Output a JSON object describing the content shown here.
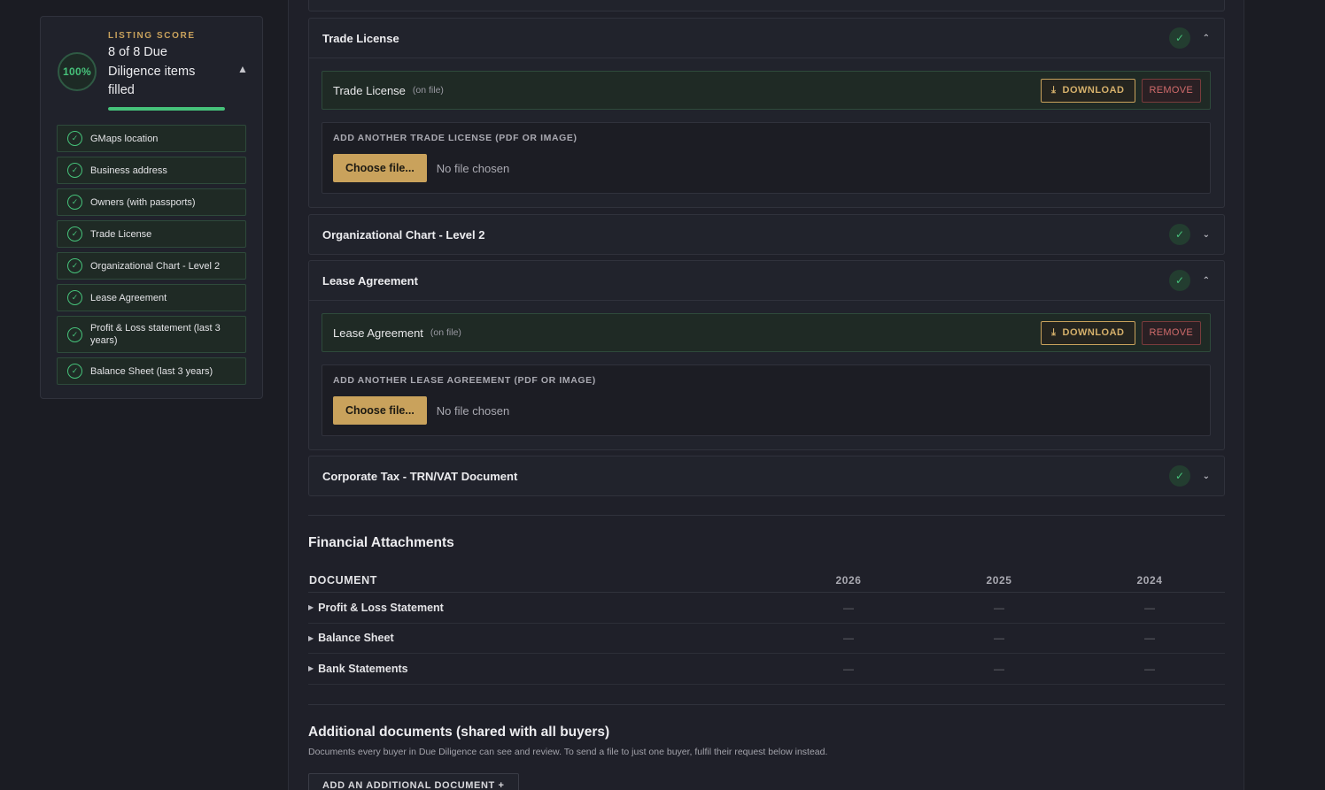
{
  "score": {
    "eyebrow": "LISTING SCORE",
    "percent": "100%",
    "summary": "8 of 8 Due Diligence items filled",
    "progress_fraction": 1.0,
    "collapse_glyph": "▲"
  },
  "checklist": [
    {
      "label": "GMaps location"
    },
    {
      "label": "Business address"
    },
    {
      "label": "Owners (with passports)"
    },
    {
      "label": "Trade License"
    },
    {
      "label": "Organizational Chart - Level 2"
    },
    {
      "label": "Lease Agreement"
    },
    {
      "label": "Profit & Loss statement (last 3 years)"
    },
    {
      "label": "Balance Sheet (last 3 years)"
    }
  ],
  "check_glyph": "✓",
  "documents": {
    "trade_license": {
      "title": "Trade License",
      "file_name": "Trade License",
      "on_file": "(on file)",
      "download": "DOWNLOAD",
      "remove": "REMOVE",
      "upload_label": "ADD ANOTHER TRADE LICENSE (PDF OR IMAGE)",
      "choose": "Choose file...",
      "no_file": "No file chosen"
    },
    "org_chart": {
      "title": "Organizational Chart - Level 2"
    },
    "lease": {
      "title": "Lease Agreement",
      "file_name": "Lease Agreement",
      "on_file": "(on file)",
      "download": "DOWNLOAD",
      "remove": "REMOVE",
      "upload_label": "ADD ANOTHER LEASE AGREEMENT (PDF OR IMAGE)",
      "choose": "Choose file...",
      "no_file": "No file chosen"
    },
    "corporate_tax": {
      "title": "Corporate Tax - TRN/VAT Document"
    }
  },
  "financial": {
    "title": "Financial Attachments",
    "columns": [
      "DOCUMENT",
      "2026",
      "2025",
      "2024"
    ],
    "rows": [
      {
        "label": "Profit & Loss Statement",
        "cells": [
          "—",
          "—",
          "—"
        ]
      },
      {
        "label": "Balance Sheet",
        "cells": [
          "—",
          "—",
          "—"
        ]
      },
      {
        "label": "Bank Statements",
        "cells": [
          "—",
          "—",
          "—"
        ]
      }
    ]
  },
  "additional": {
    "title": "Additional documents (shared with all buyers)",
    "description": "Documents every buyer in Due Diligence can see and review. To send a file to just one buyer, fulfil their request below instead.",
    "add_button": "ADD AN ADDITIONAL DOCUMENT +"
  },
  "colors": {
    "accent_gold": "#c9a25c",
    "success_green": "#46c27a",
    "danger_red": "#d06b6b",
    "background": "#1b1c23"
  }
}
